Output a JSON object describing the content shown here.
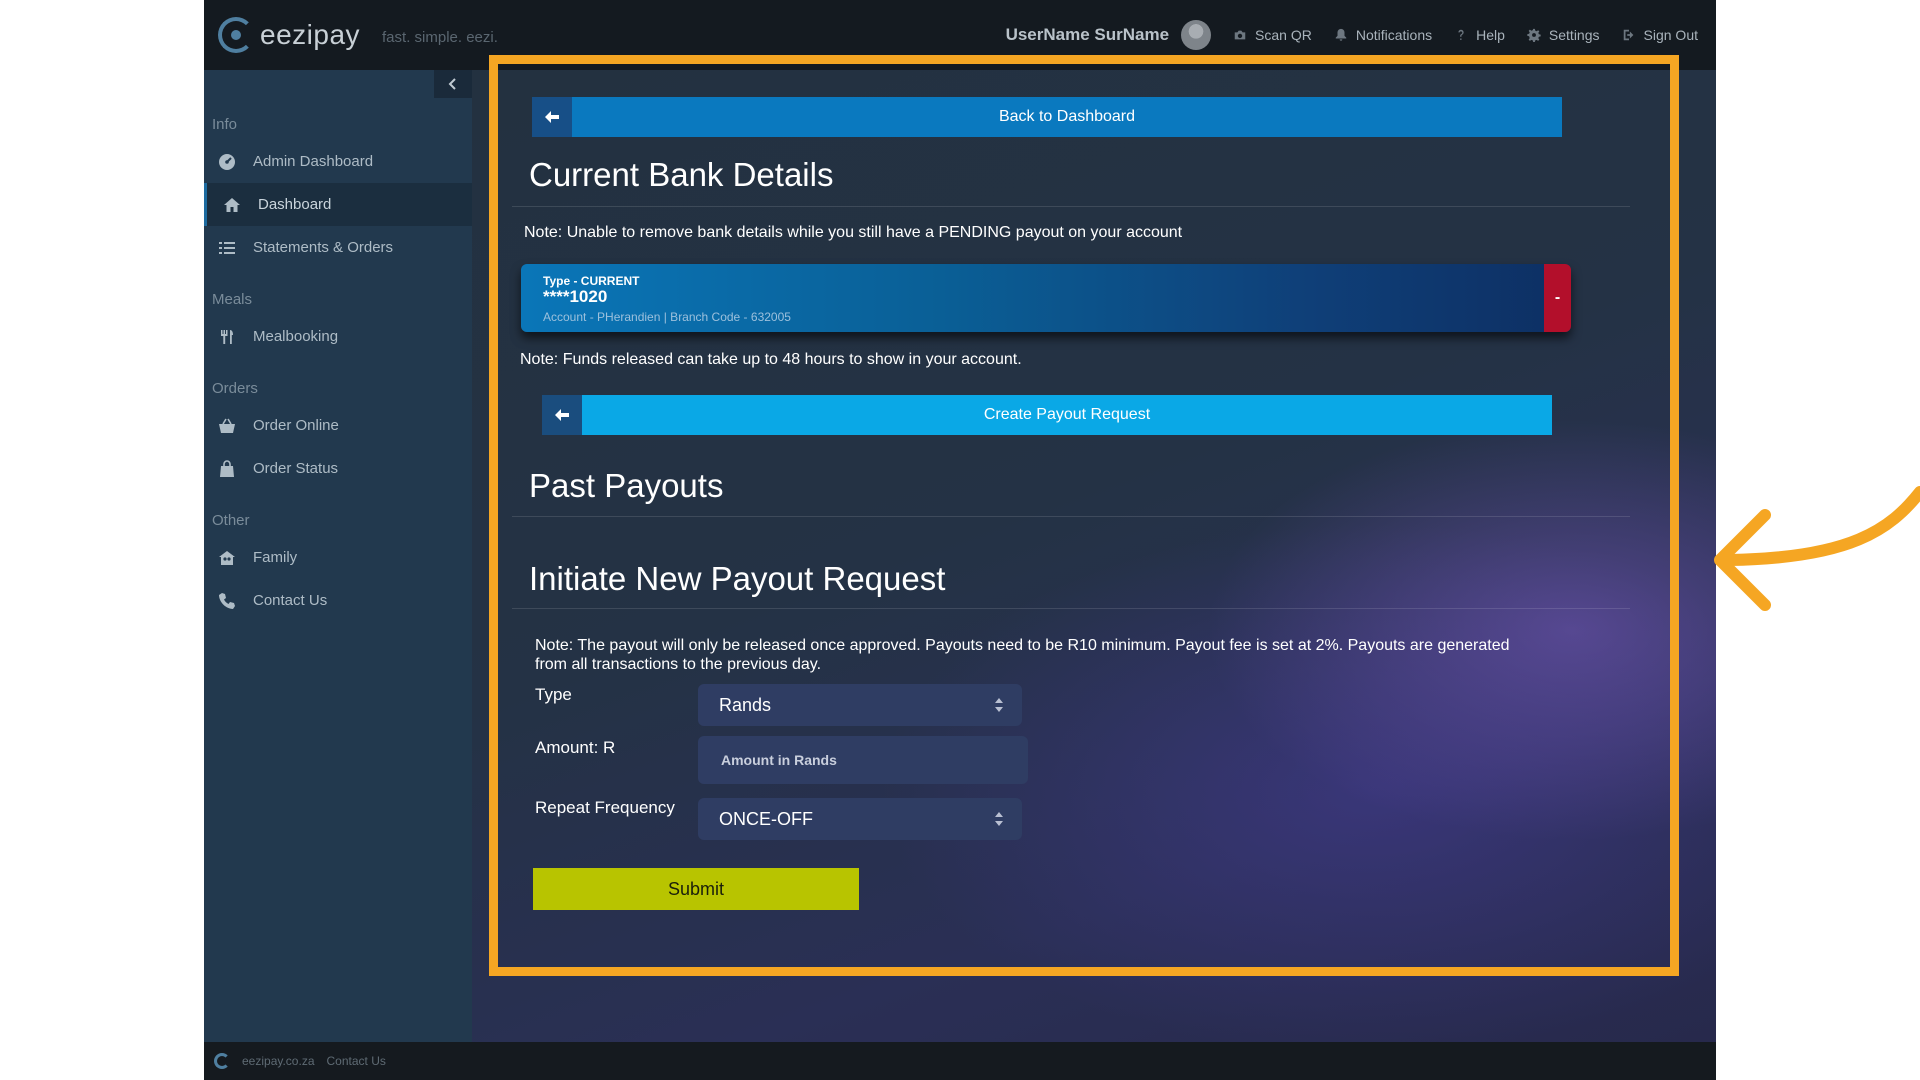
{
  "app": {
    "logo_text": "eezipay",
    "tagline": "fast. simple. eezi."
  },
  "topbar": {
    "username": "UserName SurName",
    "items": [
      {
        "label": "Scan QR",
        "icon": "camera-icon"
      },
      {
        "label": "Notifications",
        "icon": "bell-icon"
      },
      {
        "label": "Help",
        "icon": "question-icon"
      },
      {
        "label": "Settings",
        "icon": "gear-icon"
      },
      {
        "label": "Sign Out",
        "icon": "sign-out-icon"
      }
    ]
  },
  "sidebar": {
    "sections": {
      "info": "Info",
      "meals": "Meals",
      "orders": "Orders",
      "other": "Other"
    },
    "items": {
      "admin_dashboard": "Admin Dashboard",
      "dashboard": "Dashboard",
      "statements": "Statements & Orders",
      "mealbooking": "Mealbooking",
      "order_online": "Order Online",
      "order_status": "Order Status",
      "family": "Family",
      "contact": "Contact Us"
    }
  },
  "main": {
    "back_button": "Back to Dashboard",
    "current_bank_title": "Current Bank Details",
    "pending_note": "Note: Unable to remove bank details while you still have a PENDING payout on your account",
    "bank_card": {
      "type": "Type - CURRENT",
      "number": "****1020",
      "meta": "Account - PHerandien | Branch Code - 632005",
      "remove": "-"
    },
    "funds_note": "Note: Funds released can take up to 48 hours to show in your account.",
    "payout_button": "Create Payout Request",
    "past_payouts_title": "Past Payouts",
    "initiate_title": "Initiate New Payout Request",
    "form_note": "Note: The payout will only be released once approved. Payouts need to be R10 minimum. Payout fee is set at 2%. Payouts are generated from all transactions to the previous day.",
    "form": {
      "type_label": "Type",
      "type_value": "Rands",
      "amount_label": "Amount: R",
      "amount_placeholder": "Amount in Rands",
      "frequency_label": "Repeat Frequency",
      "frequency_value": "ONCE-OFF",
      "submit": "Submit"
    }
  },
  "footer": {
    "site": "eezipay.co.za",
    "contact": "Contact Us"
  },
  "colors": {
    "highlight": "#f5a623",
    "primary_button": "#0a79bf",
    "secondary_button": "#0aa8e6",
    "submit_button": "#b8c400",
    "remove_button": "#b30f2b"
  }
}
